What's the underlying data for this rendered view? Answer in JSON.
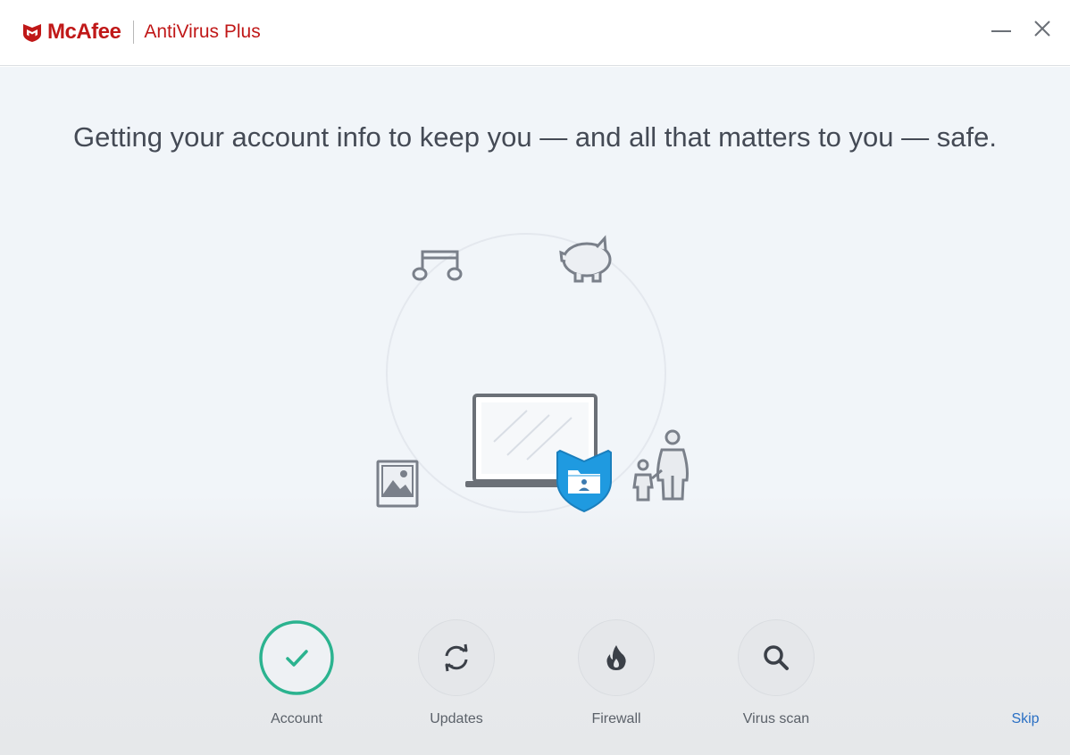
{
  "window": {
    "brand_name": "McAfee",
    "product_name": "AntiVirus Plus",
    "minimize_icon": "minimize-icon",
    "close_icon": "close-icon"
  },
  "main": {
    "headline": "Getting your account info to keep you — and all that matters to you — safe.",
    "illustration_icons": [
      "music-note-icon",
      "piggy-bank-icon",
      "photo-icon",
      "laptop-icon",
      "shield-folder-icon",
      "family-icon",
      "document-icon"
    ]
  },
  "steps": [
    {
      "label": "Account",
      "icon": "check-icon",
      "state": "complete"
    },
    {
      "label": "Updates",
      "icon": "refresh-icon",
      "state": "pending"
    },
    {
      "label": "Firewall",
      "icon": "flame-icon",
      "state": "pending"
    },
    {
      "label": "Virus scan",
      "icon": "search-icon",
      "state": "pending"
    }
  ],
  "skip_label": "Skip",
  "colors": {
    "brand_red": "#c01818",
    "complete_green": "#2bb38f",
    "link_blue": "#2a6fc4",
    "shield_blue": "#1f9ae0"
  }
}
